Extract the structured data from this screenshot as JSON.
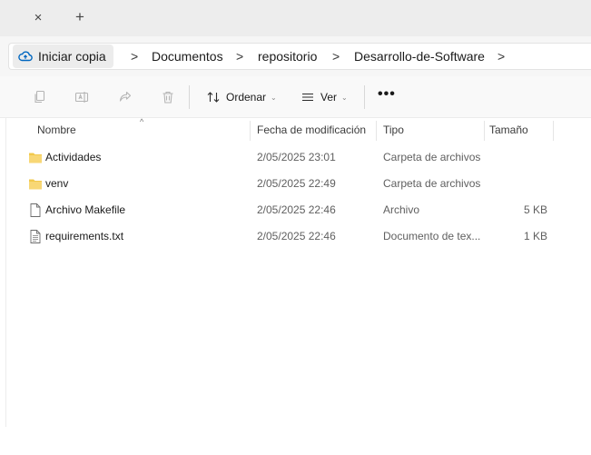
{
  "tabbar": {
    "close_glyph": "×",
    "new_tab_glyph": "+"
  },
  "breadcrumb": {
    "items": [
      "Iniciar copia",
      "Documentos",
      "repositorio",
      "Desarrollo-de-Software"
    ],
    "separator": ">"
  },
  "toolbar": {
    "sort_label": "Ordenar",
    "view_label": "Ver",
    "more_label": "•••"
  },
  "columns": {
    "name": "Nombre",
    "date": "Fecha de modificación",
    "type": "Tipo",
    "size": "Tamaño"
  },
  "files": [
    {
      "name": "Actividades",
      "date": "2/05/2025 23:01",
      "type": "Carpeta de archivos",
      "size": "",
      "icon": "folder-icon"
    },
    {
      "name": "venv",
      "date": "2/05/2025 22:49",
      "type": "Carpeta de archivos",
      "size": "",
      "icon": "folder-icon"
    },
    {
      "name": "Archivo Makefile",
      "date": "2/05/2025 22:46",
      "type": "Archivo",
      "size": "5 KB",
      "icon": "file-icon"
    },
    {
      "name": "requirements.txt",
      "date": "2/05/2025 22:46",
      "type": "Documento de tex...",
      "size": "1 KB",
      "icon": "text-file-icon"
    }
  ],
  "colors": {
    "folder": "#F2C94C",
    "accent": "#0067C0"
  }
}
